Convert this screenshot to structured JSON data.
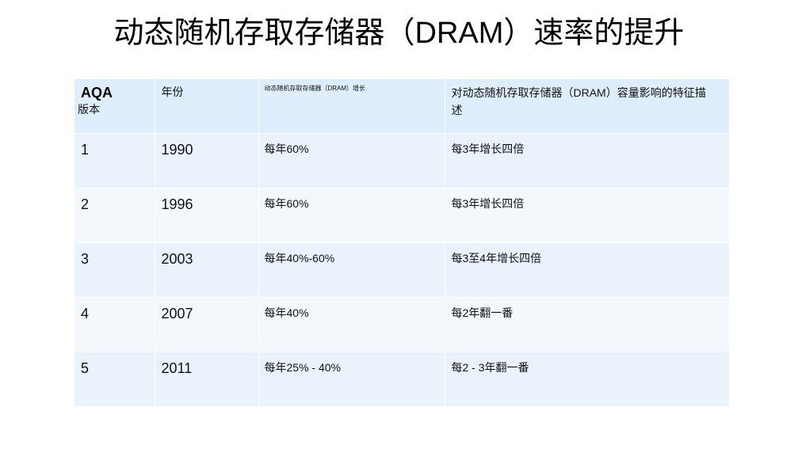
{
  "title": "动态随机存取存储器（DRAM）速率的提升",
  "table": {
    "headers": {
      "version_line1": "AQA",
      "version_line2": "版本",
      "year": "年份",
      "growth": "动态随机存取存储器（DRAM）增长",
      "description": "对动态随机存取存储器（DRAM）容量影响的特征描述"
    },
    "rows": [
      {
        "version": "1",
        "year": "1990",
        "growth": "每年60%",
        "description": "每3年增长四倍"
      },
      {
        "version": "2",
        "year": "1996",
        "growth": "每年60%",
        "description": "每3年增长四倍"
      },
      {
        "version": "3",
        "year": "2003",
        "growth": "每年40%-60%",
        "description": "每3至4年增长四倍"
      },
      {
        "version": "4",
        "year": "2007",
        "growth": "每年40%",
        "description": "每2年翻一番"
      },
      {
        "version": "5",
        "year": "2011",
        "growth": "每年25% - 40%",
        "description": "每2 - 3年翻一番"
      }
    ]
  },
  "colors": {
    "header_bg": "#deeefc",
    "row_bg_odd": "#eaf3fc",
    "row_bg_even": "#f3f8fd"
  }
}
